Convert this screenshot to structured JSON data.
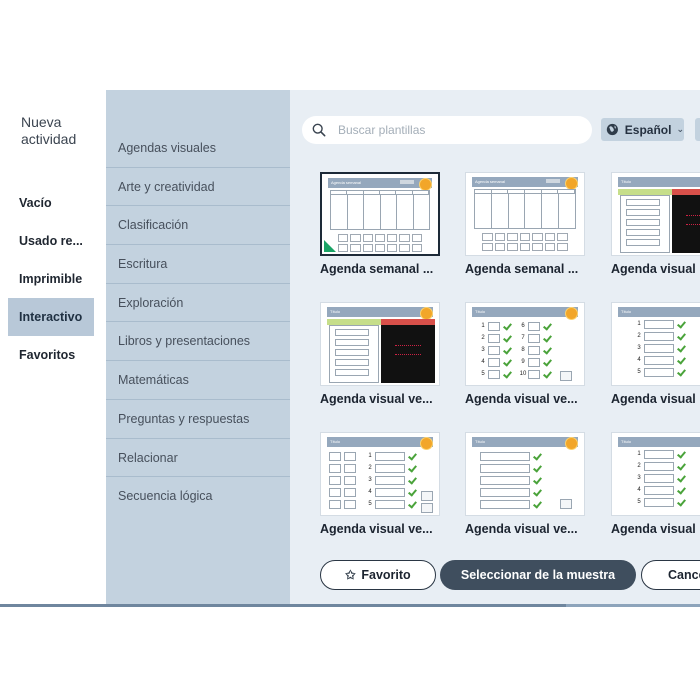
{
  "left_nav": {
    "title": "Nueva actividad",
    "items": [
      {
        "label": "Vacío",
        "active": false
      },
      {
        "label": "Usado re...",
        "active": false
      },
      {
        "label": "Imprimible",
        "active": false
      },
      {
        "label": "Interactivo",
        "active": true
      },
      {
        "label": "Favoritos",
        "active": false
      }
    ]
  },
  "categories": [
    "Agendas visuales",
    "Arte y creatividad",
    "Clasificación",
    "Escritura",
    "Exploración",
    "Libros y presentaciones",
    "Matemáticas",
    "Preguntas y respuestas",
    "Relacionar",
    "Secuencia lógica"
  ],
  "search": {
    "placeholder": "Buscar plantillas",
    "value": ""
  },
  "language": {
    "label": "Español"
  },
  "templates": [
    {
      "label": "Agenda semanal ...",
      "thumb_title": "Agenda semanal",
      "selected": true
    },
    {
      "label": "Agenda semanal ...",
      "thumb_title": "Agenda semanal",
      "selected": false
    },
    {
      "label": "Agenda visual",
      "thumb_title": "Título",
      "selected": false
    },
    {
      "label": "Agenda visual ve...",
      "thumb_title": "Título",
      "selected": false
    },
    {
      "label": "Agenda visual ve...",
      "thumb_title": "Título",
      "selected": false
    },
    {
      "label": "Agenda visual",
      "thumb_title": "Título",
      "selected": false
    },
    {
      "label": "Agenda visual ve...",
      "thumb_title": "Título",
      "selected": false
    },
    {
      "label": "Agenda visual ve...",
      "thumb_title": "Título",
      "selected": false
    },
    {
      "label": "Agenda visual",
      "thumb_title": "Título",
      "selected": false
    }
  ],
  "buttons": {
    "favorite": "Favorito",
    "select": "Seleccionar de la muestra",
    "cancel": "Cancelar"
  },
  "colors": {
    "sidebar_bg": "#c3d2df",
    "main_bg": "#e8eef4",
    "active_nav": "#b8c8d8",
    "primary_button": "#3f4e5e",
    "badge": "#f2a629",
    "check": "#4aa33a"
  }
}
